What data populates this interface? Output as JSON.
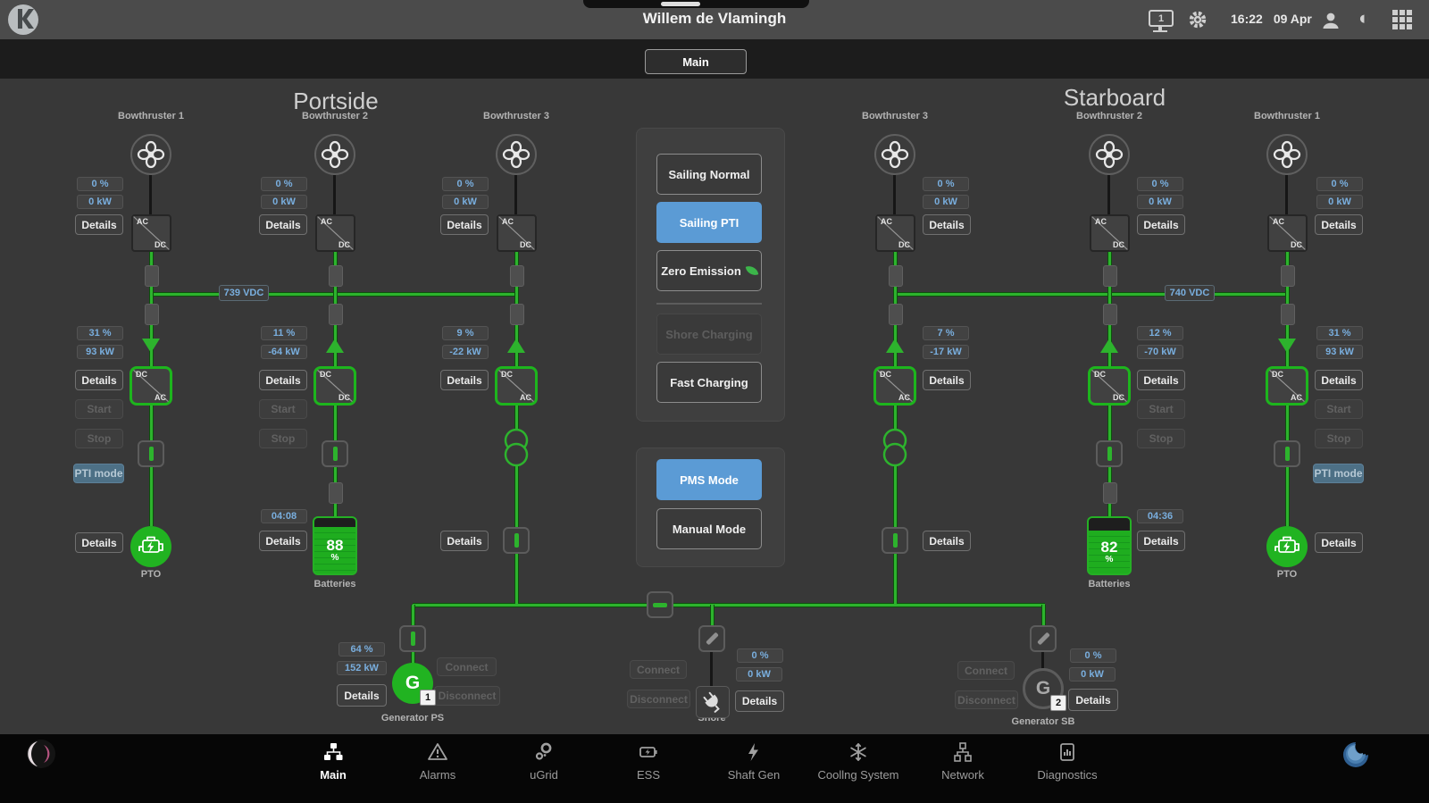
{
  "titlebar": {
    "title": "Willem de Vlamingh",
    "time": "16:22",
    "date": "09 Apr",
    "monitor_number": "1"
  },
  "tab_main": "Main",
  "sections": {
    "portside": "Portside",
    "starboard": "Starboard"
  },
  "common": {
    "details": "Details",
    "start": "Start",
    "stop": "Stop",
    "pti_mode": "PTI mode",
    "connect": "Connect",
    "disconnect": "Disconnect",
    "batteries_label": "Batteries",
    "pto_label": "PTO"
  },
  "converter_units": {
    "ac": "AC",
    "dc": "DC"
  },
  "mode_panel": {
    "sailing_normal": "Sailing Normal",
    "sailing_pti": "Sailing PTI",
    "zero_emission": "Zero Emission",
    "shore_charging": "Shore Charging",
    "fast_charging": "Fast Charging"
  },
  "control_panel": {
    "pms_mode": "PMS Mode",
    "manual_mode": "Manual Mode"
  },
  "buses": {
    "portside_voltage": "739 VDC",
    "starboard_voltage": "740 VDC"
  },
  "thrusters": {
    "p1": {
      "name": "Bowthruster 1",
      "top_pct": "0 %",
      "top_kw": "0 kW",
      "mid_pct": "31 %",
      "mid_kw": "93 kW"
    },
    "p2": {
      "name": "Bowthruster 2",
      "top_pct": "0 %",
      "top_kw": "0 kW",
      "mid_pct": "11 %",
      "mid_kw": "-64 kW"
    },
    "p3": {
      "name": "Bowthruster 3",
      "top_pct": "0 %",
      "top_kw": "0 kW",
      "mid_pct": "9 %",
      "mid_kw": "-22 kW"
    },
    "s3": {
      "name": "Bowthruster 3",
      "top_pct": "0 %",
      "top_kw": "0 kW",
      "mid_pct": "7 %",
      "mid_kw": "-17 kW"
    },
    "s2": {
      "name": "Bowthruster 2",
      "top_pct": "0 %",
      "top_kw": "0 kW",
      "mid_pct": "12 %",
      "mid_kw": "-70 kW"
    },
    "s1": {
      "name": "Bowthruster 1",
      "top_pct": "0 %",
      "top_kw": "0 kW",
      "mid_pct": "31 %",
      "mid_kw": "93 kW"
    }
  },
  "batteries": {
    "port": {
      "soc": "88",
      "unit": "%",
      "timer": "04:08"
    },
    "starboard": {
      "soc": "82",
      "unit": "%",
      "timer": "04:36"
    }
  },
  "generators": {
    "ps": {
      "label": "Generator PS",
      "letter": "G",
      "number": "1",
      "pct": "64 %",
      "kw": "152 kW"
    },
    "sb": {
      "label": "Generator SB",
      "letter": "G",
      "number": "2",
      "pct": "0 %",
      "kw": "0 kW"
    }
  },
  "shore": {
    "label": "Shore",
    "pct": "0 %",
    "kw": "0 kW"
  },
  "nav": {
    "items": [
      {
        "label": "Main"
      },
      {
        "label": "Alarms"
      },
      {
        "label": "uGrid"
      },
      {
        "label": "ESS"
      },
      {
        "label": "Shaft Gen"
      },
      {
        "label": "Coollng System"
      },
      {
        "label": "Network"
      },
      {
        "label": "Diagnostics"
      }
    ]
  },
  "colors": {
    "accent_blue": "#5b9bd5",
    "signal_green": "#2db32d",
    "value_blue": "#79aede",
    "pti_active_bg": "#4d7086"
  }
}
